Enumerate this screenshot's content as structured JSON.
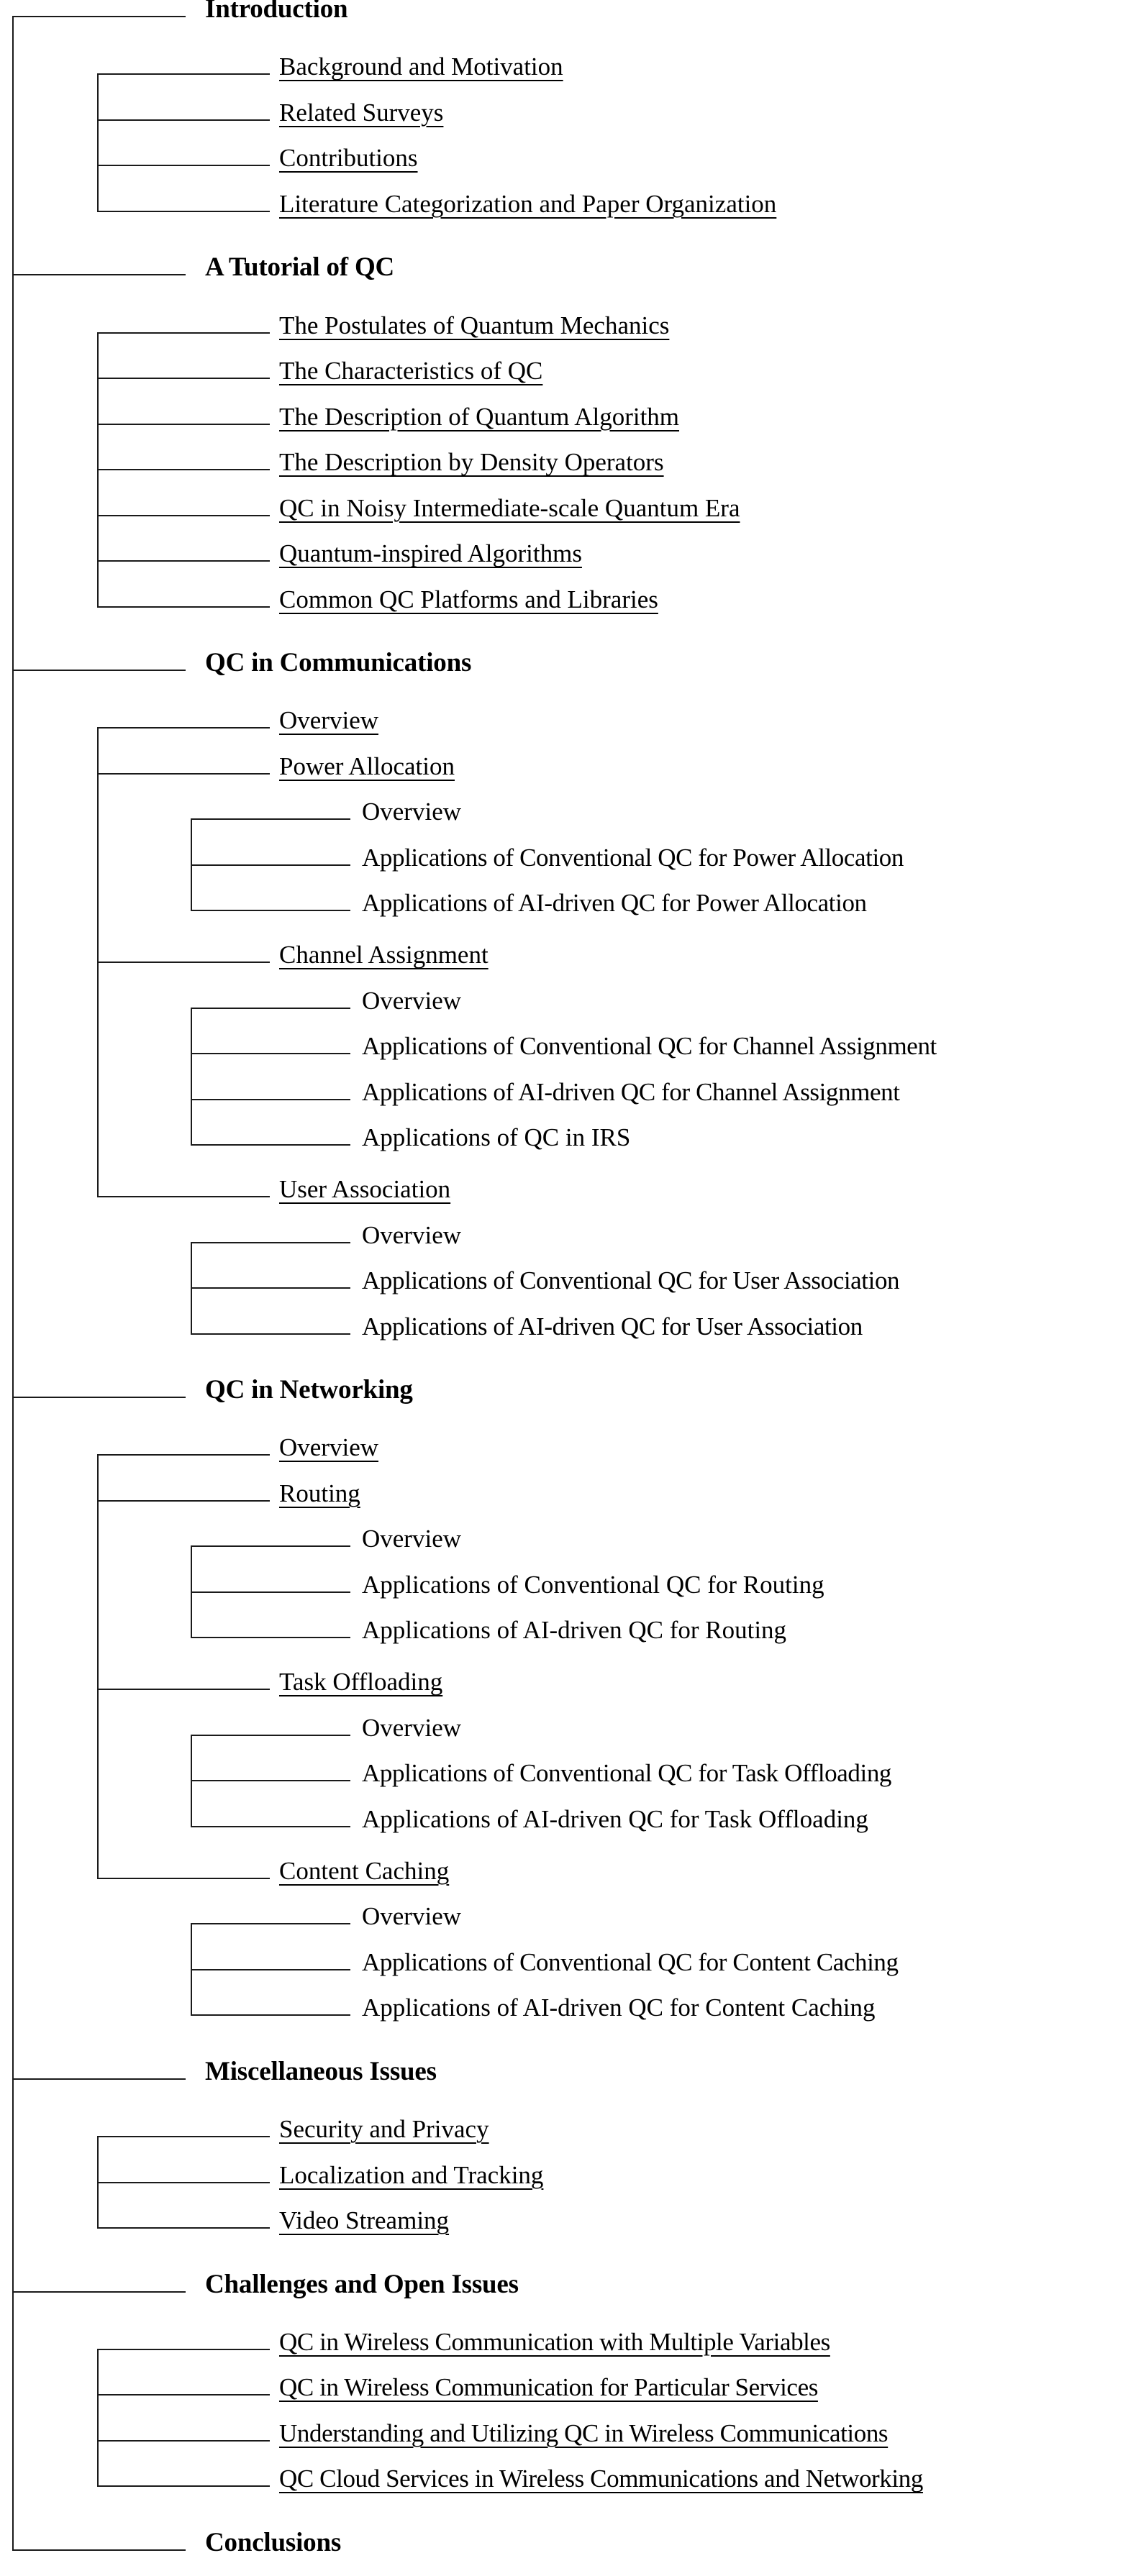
{
  "figure": {
    "kind": "paper-organization-tree",
    "spine_color": "#1a1a1a",
    "levels": 3,
    "sections": [
      {
        "level": 0,
        "label": "Introduction",
        "children": [
          {
            "level": 1,
            "label": "Background and Motivation"
          },
          {
            "level": 1,
            "label": "Related Surveys"
          },
          {
            "level": 1,
            "label": "Contributions"
          },
          {
            "level": 1,
            "label": "Literature Categorization and Paper Organization"
          }
        ]
      },
      {
        "level": 0,
        "label": "A Tutorial of QC",
        "children": [
          {
            "level": 1,
            "label": "The Postulates of Quantum Mechanics"
          },
          {
            "level": 1,
            "label": "The Characteristics of QC"
          },
          {
            "level": 1,
            "label": "The Description of Quantum Algorithm"
          },
          {
            "level": 1,
            "label": "The Description by Density Operators"
          },
          {
            "level": 1,
            "label": "QC in Noisy Intermediate-scale Quantum Era"
          },
          {
            "level": 1,
            "label": "Quantum-inspired Algorithms"
          },
          {
            "level": 1,
            "label": "Common QC Platforms and Libraries"
          }
        ]
      },
      {
        "level": 0,
        "label": "QC in Communications",
        "children": [
          {
            "level": 1,
            "label": "Overview"
          },
          {
            "level": 1,
            "label": "Power Allocation",
            "children": [
              {
                "level": 2,
                "label": "Overview"
              },
              {
                "level": 2,
                "label": "Applications of Conventional QC for Power Allocation"
              },
              {
                "level": 2,
                "label": "Applications of AI-driven QC for Power Allocation"
              }
            ]
          },
          {
            "level": 1,
            "label": "Channel Assignment",
            "children": [
              {
                "level": 2,
                "label": "Overview"
              },
              {
                "level": 2,
                "label": "Applications of Conventional QC for Channel Assignment"
              },
              {
                "level": 2,
                "label": "Applications of AI-driven QC for Channel Assignment"
              },
              {
                "level": 2,
                "label": "Applications of QC in IRS"
              }
            ]
          },
          {
            "level": 1,
            "label": "User Association",
            "children": [
              {
                "level": 2,
                "label": "Overview"
              },
              {
                "level": 2,
                "label": "Applications of Conventional QC for User Association"
              },
              {
                "level": 2,
                "label": "Applications of AI-driven QC for User Association"
              }
            ]
          }
        ]
      },
      {
        "level": 0,
        "label": "QC in Networking",
        "children": [
          {
            "level": 1,
            "label": "Overview"
          },
          {
            "level": 1,
            "label": "Routing",
            "children": [
              {
                "level": 2,
                "label": "Overview"
              },
              {
                "level": 2,
                "label": "Applications of Conventional QC for Routing"
              },
              {
                "level": 2,
                "label": "Applications of AI-driven QC for Routing"
              }
            ]
          },
          {
            "level": 1,
            "label": "Task Offloading",
            "children": [
              {
                "level": 2,
                "label": "Overview"
              },
              {
                "level": 2,
                "label": "Applications of Conventional QC for Task Offloading"
              },
              {
                "level": 2,
                "label": "Applications of AI-driven QC for Task Offloading"
              }
            ]
          },
          {
            "level": 1,
            "label": "Content Caching",
            "children": [
              {
                "level": 2,
                "label": "Overview"
              },
              {
                "level": 2,
                "label": "Applications of Conventional QC for Content Caching"
              },
              {
                "level": 2,
                "label": "Applications of AI-driven QC for Content Caching"
              }
            ]
          }
        ]
      },
      {
        "level": 0,
        "label": "Miscellaneous Issues",
        "children": [
          {
            "level": 1,
            "label": "Security and Privacy"
          },
          {
            "level": 1,
            "label": "Localization and Tracking"
          },
          {
            "level": 1,
            "label": "Video Streaming"
          }
        ]
      },
      {
        "level": 0,
        "label": "Challenges and Open Issues",
        "children": [
          {
            "level": 1,
            "label": "QC in Wireless Communication with Multiple Variables"
          },
          {
            "level": 1,
            "label": "QC in Wireless Communication for Particular Services"
          },
          {
            "level": 1,
            "label": "Understanding and Utilizing QC in Wireless Communications"
          },
          {
            "level": 1,
            "label": "QC Cloud Services in Wireless Communications and Networking"
          }
        ]
      },
      {
        "level": 0,
        "label": "Conclusions",
        "children": []
      }
    ]
  }
}
